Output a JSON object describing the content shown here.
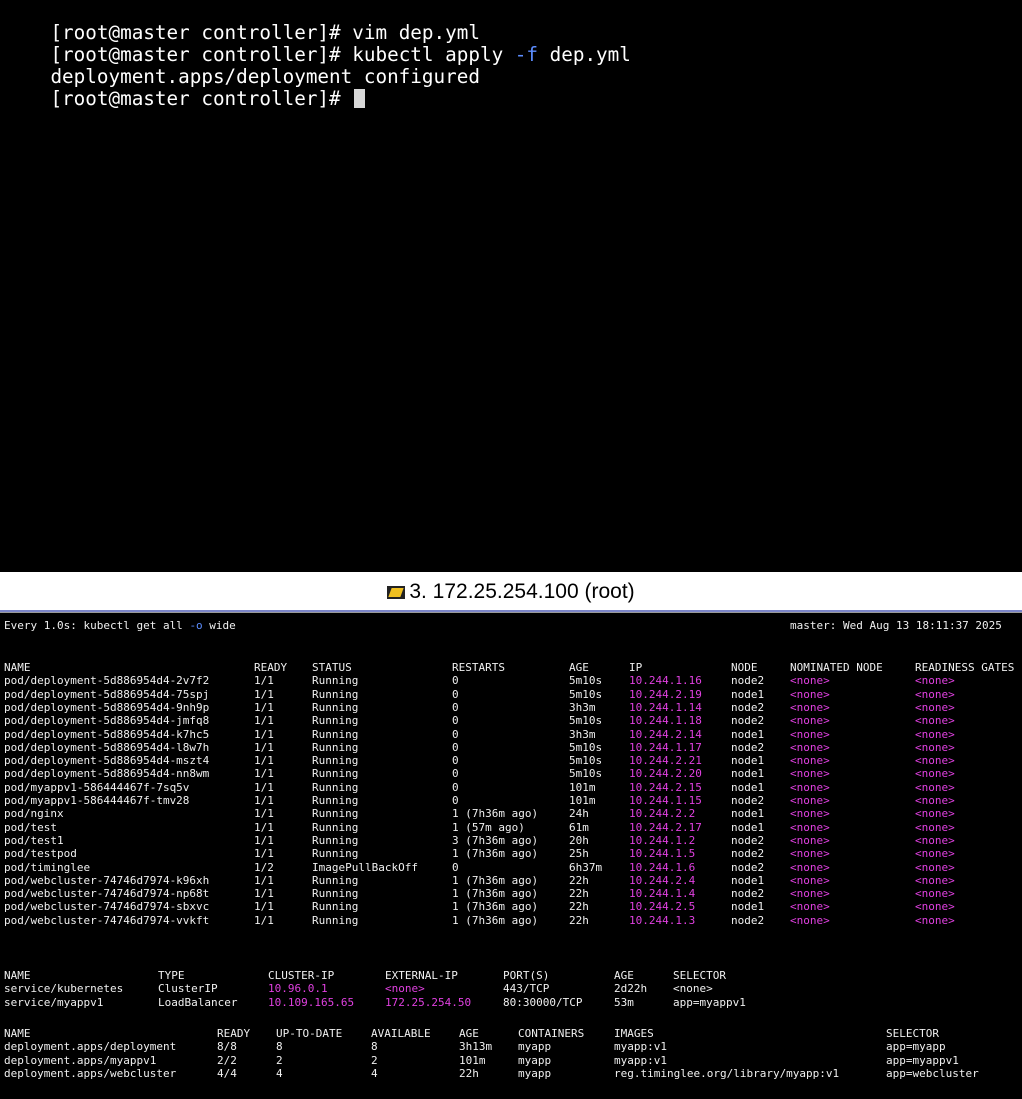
{
  "top_terminal": {
    "lines": [
      {
        "prompt": "[root@master controller]# ",
        "cmd": "vim dep.yml"
      },
      {
        "prompt": "[root@master controller]# ",
        "cmd_a": "kubectl apply ",
        "flag": "-f",
        "cmd_b": " dep.yml"
      },
      {
        "output": "deployment.apps/deployment configured"
      },
      {
        "prompt": "[root@master controller]# "
      }
    ]
  },
  "tab": {
    "title": "3. 172.25.254.100 (root)"
  },
  "watch": {
    "header_left_a": "Every 1.0s: kubectl get all ",
    "header_flag": "-o",
    "header_left_b": " wide",
    "header_right": "master: Wed Aug 13 18:11:37 2025"
  },
  "pods": {
    "headers": [
      "NAME",
      "READY",
      "STATUS",
      "RESTARTS",
      "AGE",
      "IP",
      "NODE",
      "NOMINATED NODE",
      "READINESS GATES"
    ],
    "rows": [
      [
        "pod/deployment-5d886954d4-2v7f2",
        "1/1",
        "Running",
        "0",
        "5m10s",
        "10.244.1.16",
        "node2",
        "<none>",
        "<none>"
      ],
      [
        "pod/deployment-5d886954d4-75spj",
        "1/1",
        "Running",
        "0",
        "5m10s",
        "10.244.2.19",
        "node1",
        "<none>",
        "<none>"
      ],
      [
        "pod/deployment-5d886954d4-9nh9p",
        "1/1",
        "Running",
        "0",
        "3h3m",
        "10.244.1.14",
        "node2",
        "<none>",
        "<none>"
      ],
      [
        "pod/deployment-5d886954d4-jmfq8",
        "1/1",
        "Running",
        "0",
        "5m10s",
        "10.244.1.18",
        "node2",
        "<none>",
        "<none>"
      ],
      [
        "pod/deployment-5d886954d4-k7hc5",
        "1/1",
        "Running",
        "0",
        "3h3m",
        "10.244.2.14",
        "node1",
        "<none>",
        "<none>"
      ],
      [
        "pod/deployment-5d886954d4-l8w7h",
        "1/1",
        "Running",
        "0",
        "5m10s",
        "10.244.1.17",
        "node2",
        "<none>",
        "<none>"
      ],
      [
        "pod/deployment-5d886954d4-mszt4",
        "1/1",
        "Running",
        "0",
        "5m10s",
        "10.244.2.21",
        "node1",
        "<none>",
        "<none>"
      ],
      [
        "pod/deployment-5d886954d4-nn8wm",
        "1/1",
        "Running",
        "0",
        "5m10s",
        "10.244.2.20",
        "node1",
        "<none>",
        "<none>"
      ],
      [
        "pod/myappv1-586444467f-7sq5v",
        "1/1",
        "Running",
        "0",
        "101m",
        "10.244.2.15",
        "node1",
        "<none>",
        "<none>"
      ],
      [
        "pod/myappv1-586444467f-tmv28",
        "1/1",
        "Running",
        "0",
        "101m",
        "10.244.1.15",
        "node2",
        "<none>",
        "<none>"
      ],
      [
        "pod/nginx",
        "1/1",
        "Running",
        "1 (7h36m ago)",
        "24h",
        "10.244.2.2",
        "node1",
        "<none>",
        "<none>"
      ],
      [
        "pod/test",
        "1/1",
        "Running",
        "1 (57m ago)",
        "61m",
        "10.244.2.17",
        "node1",
        "<none>",
        "<none>"
      ],
      [
        "pod/test1",
        "1/1",
        "Running",
        "3 (7h36m ago)",
        "20h",
        "10.244.1.2",
        "node2",
        "<none>",
        "<none>"
      ],
      [
        "pod/testpod",
        "1/1",
        "Running",
        "1 (7h36m ago)",
        "25h",
        "10.244.1.5",
        "node2",
        "<none>",
        "<none>"
      ],
      [
        "pod/timinglee",
        "1/2",
        "ImagePullBackOff",
        "0",
        "6h37m",
        "10.244.1.6",
        "node2",
        "<none>",
        "<none>"
      ],
      [
        "pod/webcluster-74746d7974-k96xh",
        "1/1",
        "Running",
        "1 (7h36m ago)",
        "22h",
        "10.244.2.4",
        "node1",
        "<none>",
        "<none>"
      ],
      [
        "pod/webcluster-74746d7974-np68t",
        "1/1",
        "Running",
        "1 (7h36m ago)",
        "22h",
        "10.244.1.4",
        "node2",
        "<none>",
        "<none>"
      ],
      [
        "pod/webcluster-74746d7974-sbxvc",
        "1/1",
        "Running",
        "1 (7h36m ago)",
        "22h",
        "10.244.2.5",
        "node1",
        "<none>",
        "<none>"
      ],
      [
        "pod/webcluster-74746d7974-vvkft",
        "1/1",
        "Running",
        "1 (7h36m ago)",
        "22h",
        "10.244.1.3",
        "node2",
        "<none>",
        "<none>"
      ]
    ]
  },
  "services": {
    "headers": [
      "NAME",
      "TYPE",
      "CLUSTER-IP",
      "EXTERNAL-IP",
      "PORT(S)",
      "AGE",
      "SELECTOR"
    ],
    "rows": [
      [
        "service/kubernetes",
        "ClusterIP",
        "10.96.0.1",
        "<none>",
        "443/TCP",
        "2d22h",
        "<none>"
      ],
      [
        "service/myappv1",
        "LoadBalancer",
        "10.109.165.65",
        "172.25.254.50",
        "80:30000/TCP",
        "53m",
        "app=myappv1"
      ]
    ]
  },
  "deployments": {
    "headers": [
      "NAME",
      "READY",
      "UP-TO-DATE",
      "AVAILABLE",
      "AGE",
      "CONTAINERS",
      "IMAGES",
      "SELECTOR"
    ],
    "rows": [
      [
        "deployment.apps/deployment",
        "8/8",
        "8",
        "8",
        "3h13m",
        "myapp",
        "myapp:v1",
        "app=myapp"
      ],
      [
        "deployment.apps/myappv1",
        "2/2",
        "2",
        "2",
        "101m",
        "myapp",
        "myapp:v1",
        "app=myappv1"
      ],
      [
        "deployment.apps/webcluster",
        "4/4",
        "4",
        "4",
        "22h",
        "myapp",
        "reg.timinglee.org/library/myapp:v1",
        "app=webcluster"
      ]
    ]
  },
  "colors": {
    "highlight": "#e040e0",
    "flag": "#5c8dff",
    "tab_border": "#7b85c8"
  }
}
